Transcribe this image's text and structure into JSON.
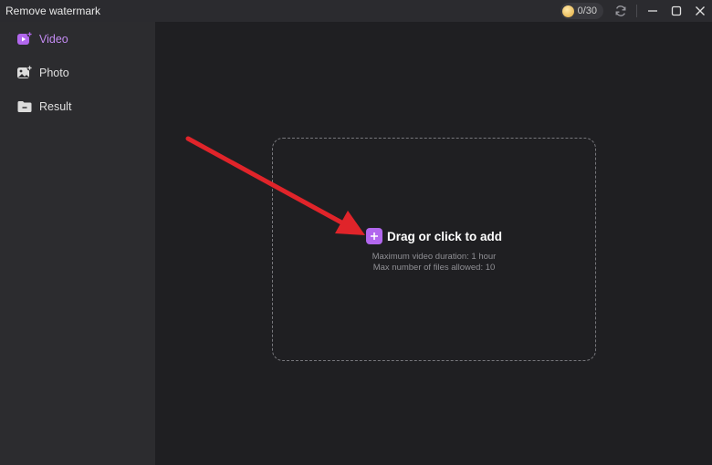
{
  "window": {
    "title": "Remove watermark",
    "credits": "0/30"
  },
  "sidebar": {
    "items": [
      {
        "label": "Video",
        "icon": "video-add-icon",
        "active": true
      },
      {
        "label": "Photo",
        "icon": "photo-add-icon",
        "active": false
      },
      {
        "label": "Result",
        "icon": "folder-icon",
        "active": false
      }
    ]
  },
  "dropzone": {
    "label": "Drag or click to add",
    "hint_duration": "Maximum video duration: 1 hour",
    "hint_files": "Max number of files allowed: 10"
  },
  "colors": {
    "accent": "#b267ee",
    "annotation_arrow": "#e0242a"
  }
}
